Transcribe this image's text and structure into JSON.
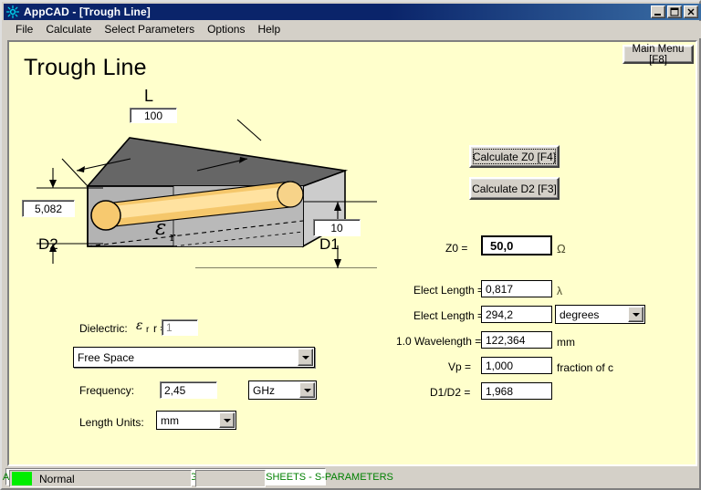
{
  "window": {
    "title": "AppCAD - [Trough Line]",
    "icon": "appcad-atom-icon",
    "controls": {
      "minimize": "minimize-icon",
      "maximize": "maximize-icon",
      "close": "close-icon"
    }
  },
  "menubar": {
    "items": [
      {
        "label": "File"
      },
      {
        "label": "Calculate"
      },
      {
        "label": "Select Parameters"
      },
      {
        "label": "Options"
      },
      {
        "label": "Help"
      }
    ]
  },
  "page": {
    "title": "Trough Line",
    "main_menu_button": "Main Menu [F8]"
  },
  "diagram": {
    "length_label": "L",
    "length_value": "100",
    "d2_value": "5,082",
    "d2_label": "D2",
    "d1_value": "10",
    "d1_label": "D1",
    "epsilon_label": "ε",
    "epsilon_sub": "r",
    "colors": {
      "box_front": "#b3b3b3",
      "box_top": "#666666",
      "box_side": "#cccccc",
      "wire": "#f5c76b",
      "wire_light": "#ffe2a0",
      "outline": "#000000"
    }
  },
  "buttons": {
    "calculate_z0": "Calculate Z0  [F4]",
    "calculate_d2": "Calculate D2  [F3]"
  },
  "results": {
    "z0_label": "Z0 =",
    "z0_value": "50,0",
    "z0_unit": "Ω",
    "elect_length_lambda_label": "Elect Length =",
    "elect_length_lambda_value": "0,817",
    "elect_length_lambda_unit": "λ",
    "elect_length_deg_label": "Elect Length =",
    "elect_length_deg_value": "294,2",
    "elect_length_deg_unit": "degrees",
    "wavelength_label": "1.0 Wavelength =",
    "wavelength_value": "122,364",
    "wavelength_unit": "mm",
    "vp_label": "Vp =",
    "vp_value": "1,000",
    "vp_unit": "fraction of c",
    "ratio_label": "D1/D2 =",
    "ratio_value": "1,968"
  },
  "inputs": {
    "dielectric_label": "Dielectric:",
    "er_eq": "r =",
    "er_value": "1",
    "material_value": "Free Space",
    "frequency_label": "Frequency:",
    "frequency_value": "2,45",
    "frequency_unit": "GHz",
    "length_units_label": "Length Units:",
    "length_units_value": "mm"
  },
  "statusbar": {
    "state": "Normal",
    "led_color": "#00ee00",
    "web_text": "Click for Web: APPLICATION NOTES - MODELS - DESIGN TIPS - DATA SHEETS - S-PARAMETERS",
    "web_color": "#008000"
  }
}
